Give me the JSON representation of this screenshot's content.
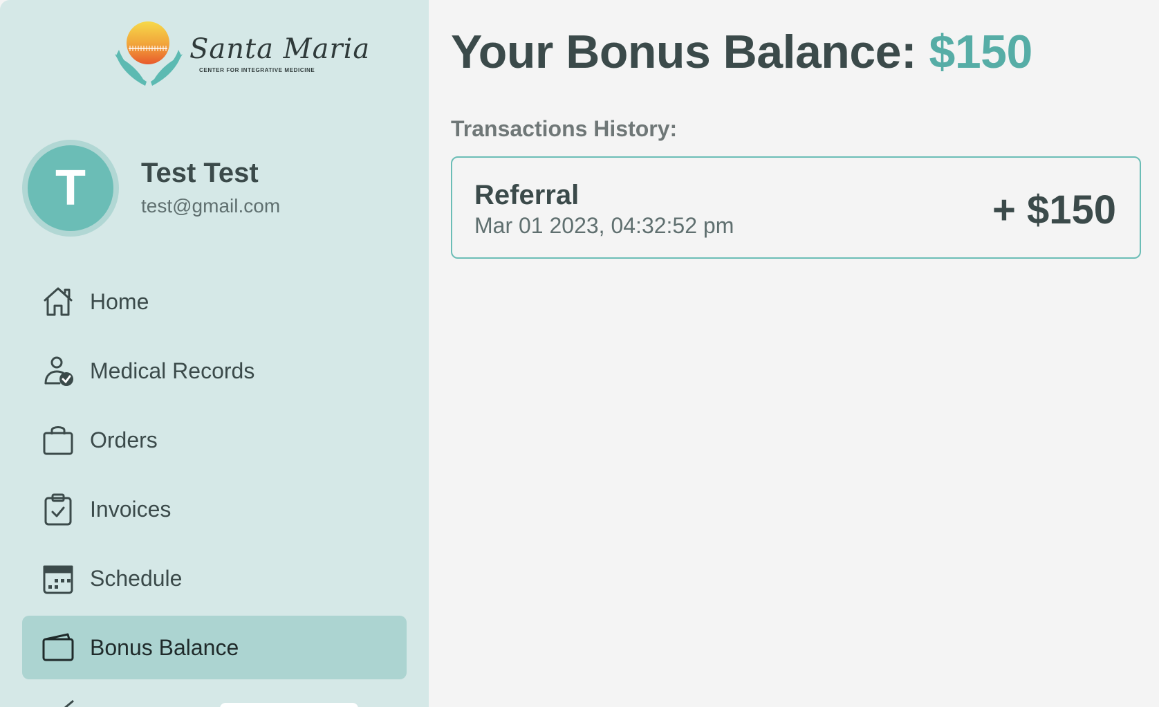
{
  "brand": {
    "logo_script": "Santa Maria",
    "logo_subtitle": "CENTER FOR INTEGRATIVE MEDICINE"
  },
  "user": {
    "initial": "T",
    "name": "Test Test",
    "email": "test@gmail.com"
  },
  "sidebar": {
    "items": [
      {
        "label": "Home",
        "icon": "home-icon"
      },
      {
        "label": "Medical Records",
        "icon": "user-check-icon"
      },
      {
        "label": "Orders",
        "icon": "shopping-bag-icon"
      },
      {
        "label": "Invoices",
        "icon": "clipboard-check-icon"
      },
      {
        "label": "Schedule",
        "icon": "calendar-icon"
      },
      {
        "label": "Bonus Balance",
        "icon": "wallet-icon",
        "active": true
      }
    ]
  },
  "main": {
    "title_prefix": "Your Bonus Balance:",
    "balance": "$150",
    "section_label": "Transactions History:",
    "transactions": [
      {
        "title": "Referral",
        "date": "Mar 01 2023, 04:32:52 pm",
        "amount": "+ $150"
      }
    ]
  },
  "colors": {
    "accent": "#56ada6",
    "sidebar_bg": "#d5e8e7",
    "active_item_bg": "#acd4d1",
    "avatar_bg": "#6bbdb6",
    "text_dark": "#3b4a4a"
  }
}
